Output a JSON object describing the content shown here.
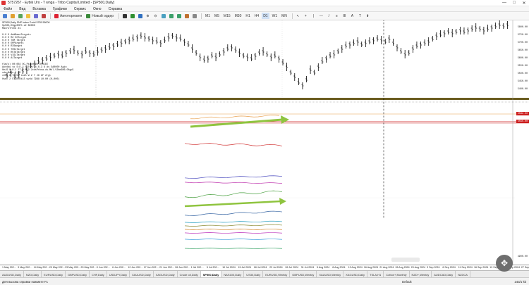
{
  "window": {
    "title": "5757267 - Eybik Uro - T wnga - Tribo Capital Limited - [SP500,Daily]",
    "minimize": "—",
    "maximize": "□",
    "close": "✕"
  },
  "menu": [
    "Файл",
    "Вид",
    "Вставка",
    "Графики",
    "Сервис",
    "Окно",
    "Справка"
  ],
  "toolbar": {
    "autotrade_label": "Автоторговля",
    "new_order_label": "Новый ордер",
    "timeframes": [
      "M1",
      "M5",
      "M15",
      "M30",
      "H1",
      "H4",
      "D1",
      "W1",
      "MN"
    ]
  },
  "chart": {
    "header": "SP500,Daily  SNP Index D-std 5755 55000",
    "info_lines": [
      "Sp500,D3gp0DFE-s2 B0000",
      "MacroTrend #1",
      "",
      "0.0 0 AddBaseTargets",
      "0.0 0 M2 5OTarget",
      "0.0 0 79M Target",
      "0.0 0 OPPArgets",
      "0.0 0 R3Sanget",
      "0.0 0 T0S1Target",
      "0.0 0 R5T8Target",
      "0.0 0 V1S1Target",
      "0.0 0 A1Target",
      "",
      "fim(s) 00:002 OC-Ptrcn-00 OFRCEE",
      "Aoroby to S:D-2 5-0 x/ x-0-3 6 ds 5A0000 Agin",
      "0eiS 0 0-2 2T-0 0 2-2cdsPrbsa-ds-Mdl-V2bm3N6-0Agdl",
      "xde Bmfo 2 L5",
      "xIMc 8 70.50 JuiS W 2 7 J6 bF 2rgt",
      "0sec 2 ST-BYBtLS wvdd 7988 10.00 (0,000)"
    ],
    "price_labels": [
      "5800.00",
      "5750.00",
      "5700.00",
      "5650.00",
      "5600.00",
      "5550.00",
      "5500.00",
      "5450.00",
      "5400.00"
    ],
    "price_tag_1": "5592.00",
    "price_tag_2": "5555.00",
    "lower_scale_labels": [
      "",
      ""
    ],
    "bottom_right_label": "4900.00",
    "blurred": ""
  },
  "time_axis": [
    "1 May 202…",
    "9 May 202…",
    "14 May 202…",
    "20 May 202…",
    "23 May 202…",
    "29 May 202…",
    "3 Jun 202…",
    "6 Jun 202…",
    "12 Jun 202…",
    "17 Jun 202…",
    "21 Jun 202…",
    "26 Jun 202…",
    "1 Jul 202…",
    "5 Jul 202…",
    "10 Jul 2024",
    "15 Jul 2024",
    "18 Jul 2024",
    "23 Jul 2024",
    "26 Jul 2024",
    "31 Jul 2024",
    "5 Aug 2024",
    "8 Aug 2024",
    "13 Aug 2024",
    "16 Aug 2024",
    "21 Aug 2024",
    "26 Aug 2024",
    "29 Aug 2024",
    "3 Sep 2024",
    "6 Sep 2024",
    "11 Sep 2024",
    "16 Sep 2024",
    "19 Sep 2024",
    "24 Sep 2024",
    "27 Sep 2024"
  ],
  "tabs": [
    {
      "label": "AUDUSD,Daily",
      "active": false
    },
    {
      "label": "NZD,Daily",
      "active": false
    },
    {
      "label": "EURUSD,Daily",
      "active": false
    },
    {
      "label": "GBPUSD,Daily",
      "active": false
    },
    {
      "label": "CHF,Daily",
      "active": false
    },
    {
      "label": "USDJPY,Daily",
      "active": false
    },
    {
      "label": "XAUUSD,Daily",
      "active": false
    },
    {
      "label": "XAGUSD,Daily",
      "active": false
    },
    {
      "label": "Crude oil,Daily",
      "active": false
    },
    {
      "label": "SP500,Daily",
      "active": true
    },
    {
      "label": "NAS100,Daily",
      "active": false
    },
    {
      "label": "US30,Daily",
      "active": false
    },
    {
      "label": "EURUSD,Weekly",
      "active": false
    },
    {
      "label": "GBPUSD,Weekly",
      "active": false
    },
    {
      "label": "XAUUSD,Weekly",
      "active": false
    },
    {
      "label": "XAGUSD,Daily",
      "active": false
    },
    {
      "label": "TSLA,H1",
      "active": false
    },
    {
      "label": "Cotton+,Monthly",
      "active": false
    },
    {
      "label": "NZD+,Weekly",
      "active": false
    },
    {
      "label": "AUDCAD,Daily",
      "active": false
    },
    {
      "label": "NZDCA",
      "active": false
    }
  ],
  "status": {
    "help": "Для вызова справки нажмите F1",
    "profile": "Default",
    "traffic": "243/1 kb"
  },
  "colors": {
    "up_candle": "#000000",
    "price_line": "#cc1d1d",
    "orange_line": "#e8a04d",
    "green_arrow": "#8fc43f"
  }
}
